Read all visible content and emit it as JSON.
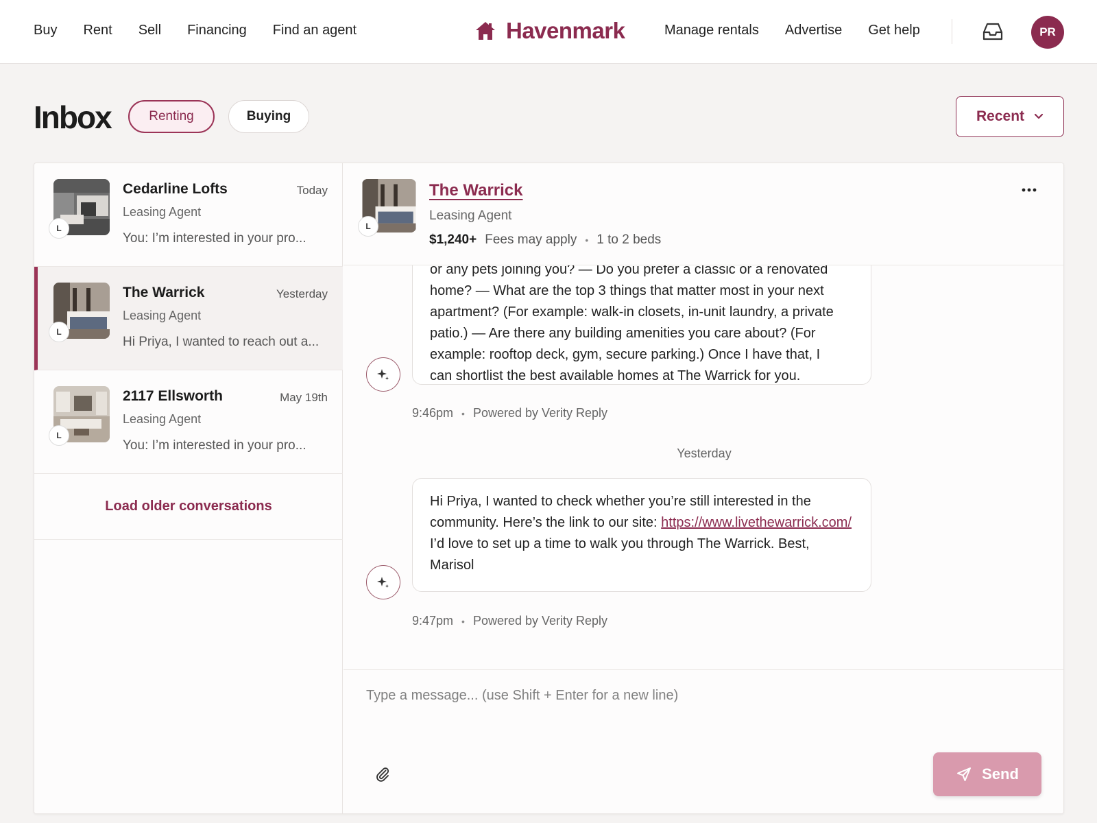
{
  "header": {
    "nav_left": [
      "Buy",
      "Rent",
      "Sell",
      "Financing",
      "Find an agent"
    ],
    "brand": "Havenmark",
    "nav_right": [
      "Manage rentals",
      "Advertise",
      "Get help"
    ],
    "avatar_initials": "PR",
    "brand_color": "#8b2b4f"
  },
  "inbox": {
    "title": "Inbox",
    "filters": [
      {
        "label": "Renting",
        "selected": true
      },
      {
        "label": "Buying",
        "selected": false
      }
    ],
    "sort_label": "Recent"
  },
  "conversations": [
    {
      "name": "Cedarline Lofts",
      "date": "Today",
      "role": "Leasing Agent",
      "preview": "You: I’m interested in your pro...",
      "badge": "L",
      "active": false
    },
    {
      "name": "The Warrick",
      "date": "Yesterday",
      "role": "Leasing Agent",
      "preview": "Hi Priya, I wanted to reach out a...",
      "badge": "L",
      "active": true
    },
    {
      "name": "2117 Ellsworth",
      "date": "May 19th",
      "role": "Leasing Agent",
      "preview": "You: I’m interested in your pro...",
      "badge": "L",
      "active": false
    }
  ],
  "load_older_label": "Load older conversations",
  "thread": {
    "property_name": "The Warrick",
    "role": "Leasing Agent",
    "badge": "L",
    "price": "$1,240+",
    "fees": "Fees may apply",
    "beds": "1 to 2 beds",
    "messages": [
      {
        "text_lines": [
          "or any pets joining you? — Do you prefer a classic or a renovated",
          "home? — What are the top 3 things that matter most in your next",
          "apartment? (For example: walk-in closets, in-unit laundry, a private",
          "patio.) — Are there any building amenities you care about? (For",
          "example: rooftop deck, gym, secure parking.) Once I have that, I",
          "can shortlist the best available homes at The Warrick for you."
        ],
        "time": "9:46pm",
        "powered_by": "Powered by Verity Reply"
      },
      {
        "text_before_link": "Hi Priya, I wanted to check whether you’re still interested in the community. Here’s the link to our site: ",
        "link": "https://www.livethewarrick.com/",
        "text_after_link": " I’d love to set up a time to walk you through The Warrick. Best, Marisol",
        "time": "9:47pm",
        "powered_by": "Powered by Verity Reply"
      }
    ],
    "day_separator": "Yesterday"
  },
  "composer": {
    "placeholder": "Type a message... (use Shift + Enter for a new line)",
    "send_label": "Send"
  }
}
